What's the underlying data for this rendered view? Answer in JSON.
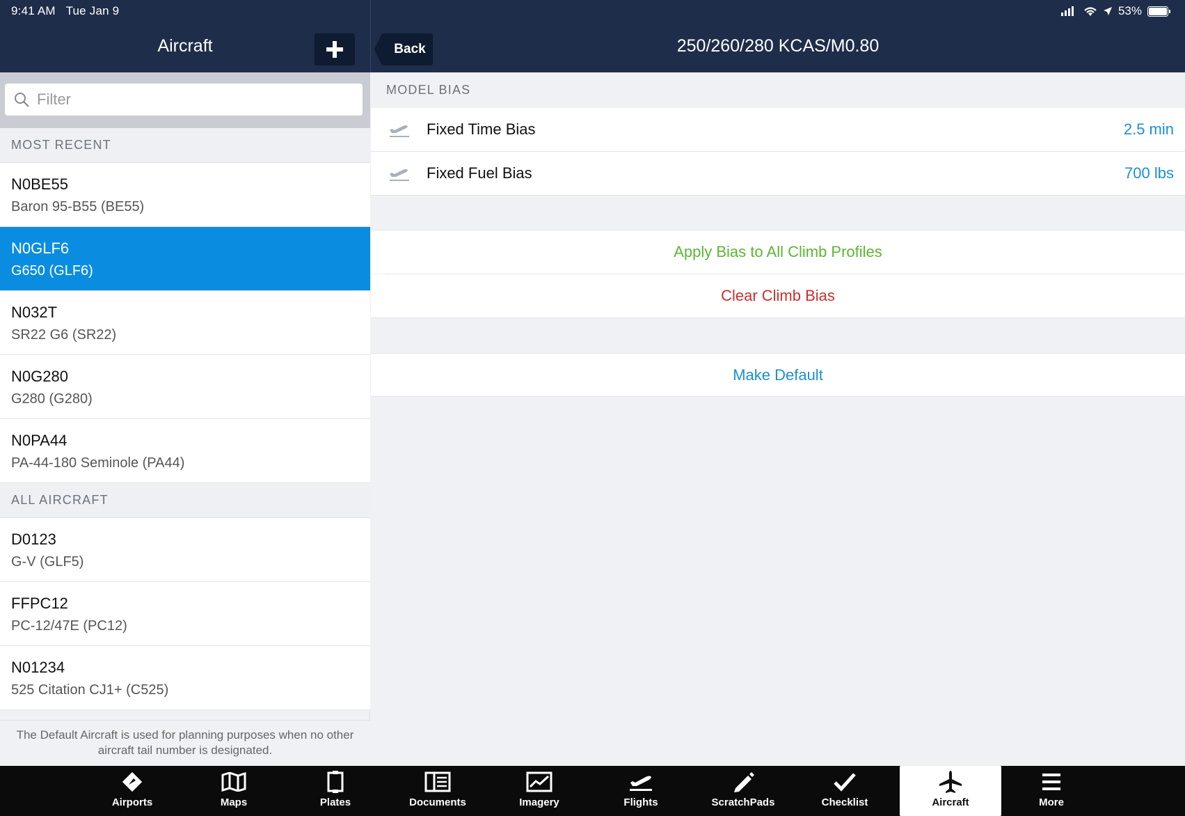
{
  "status_bar": {
    "time": "9:41 AM",
    "date": "Tue Jan 9",
    "battery": "53%"
  },
  "left_header": {
    "title": "Aircraft"
  },
  "right_header": {
    "back_label": "Back",
    "title": "250/260/280 KCAS/M0.80"
  },
  "filter": {
    "placeholder": "Filter"
  },
  "sections": {
    "most_recent": "MOST RECENT",
    "all_aircraft": "ALL AIRCRAFT"
  },
  "most_recent": [
    {
      "tail": "N0BE55",
      "model": "Baron 95-B55 (BE55)"
    },
    {
      "tail": "N0GLF6",
      "model": "G650 (GLF6)"
    },
    {
      "tail": "N032T",
      "model": "SR22 G6 (SR22)"
    },
    {
      "tail": "N0G280",
      "model": "G280 (G280)"
    },
    {
      "tail": "N0PA44",
      "model": "PA-44-180 Seminole (PA44)"
    }
  ],
  "all_aircraft": [
    {
      "tail": "D0123",
      "model": "G-V (GLF5)"
    },
    {
      "tail": "FFPC12",
      "model": "PC-12/47E (PC12)"
    },
    {
      "tail": "N01234",
      "model": "525 Citation CJ1+ (C525)"
    }
  ],
  "footnote": "The Default Aircraft is used for planning purposes when no other aircraft tail number is designated.",
  "model_bias": {
    "header": "MODEL BIAS",
    "rows": [
      {
        "label": "Fixed Time Bias",
        "value": "2.5 min"
      },
      {
        "label": "Fixed Fuel Bias",
        "value": "700 lbs"
      }
    ]
  },
  "actions": {
    "apply": "Apply Bias to All Climb Profiles",
    "clear": "Clear Climb Bias",
    "make_default": "Make Default"
  },
  "colors": {
    "header_bg": "#1e2d49",
    "selected": "#0a8de0",
    "green": "#5cb533",
    "red": "#c9302c",
    "blue": "#1a8fd6"
  },
  "tabs": [
    {
      "label": "Airports",
      "icon": "airports-icon"
    },
    {
      "label": "Maps",
      "icon": "maps-icon"
    },
    {
      "label": "Plates",
      "icon": "plates-icon"
    },
    {
      "label": "Documents",
      "icon": "documents-icon"
    },
    {
      "label": "Imagery",
      "icon": "imagery-icon"
    },
    {
      "label": "Flights",
      "icon": "flights-icon"
    },
    {
      "label": "ScratchPads",
      "icon": "scratchpads-icon"
    },
    {
      "label": "Checklist",
      "icon": "checklist-icon"
    },
    {
      "label": "Aircraft",
      "icon": "aircraft-icon"
    },
    {
      "label": "More",
      "icon": "more-icon"
    }
  ]
}
